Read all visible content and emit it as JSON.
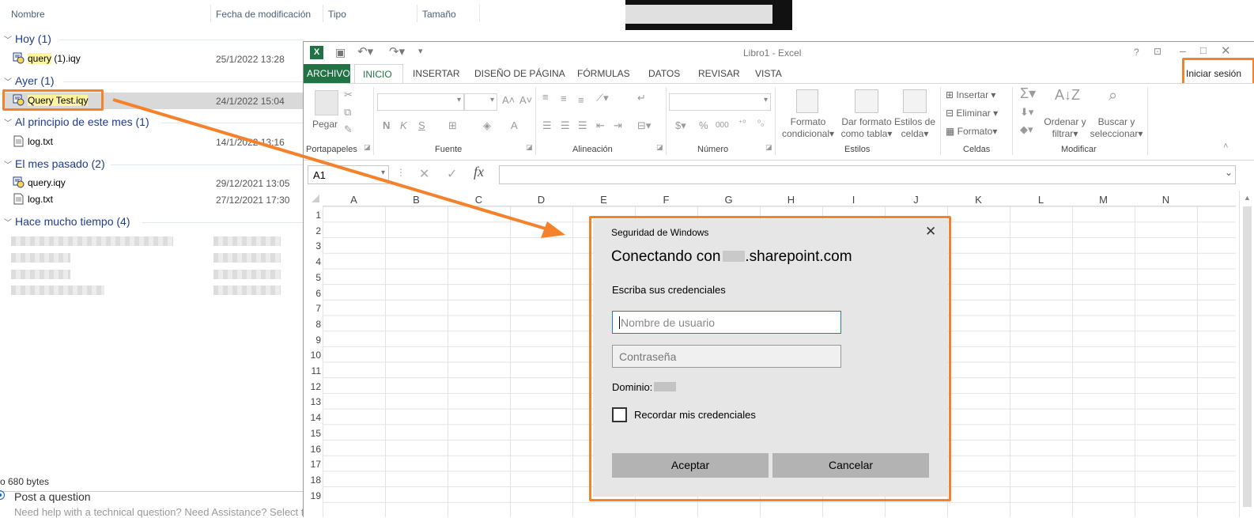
{
  "explorer": {
    "columns": [
      "Nombre",
      "Fecha de modificación",
      "Tipo",
      "Tamaño"
    ],
    "groups": [
      {
        "label": "Hoy (1)",
        "files": [
          {
            "name": "query (1).iqy",
            "hl": "query",
            "rest": " (1).iqy",
            "date": "25/1/2022 13:28"
          }
        ]
      },
      {
        "label": "Ayer (1)",
        "files": [
          {
            "name": "Query Test.iqy",
            "date": "24/1/2022 15:04"
          }
        ]
      },
      {
        "label": "Al principio de este mes (1)",
        "files": [
          {
            "name": "log.txt",
            "date": "14/1/2022 13:16"
          }
        ]
      },
      {
        "label": "El mes pasado (2)",
        "files": [
          {
            "name": "query.iqy",
            "date": "29/12/2021 13:05"
          },
          {
            "name": "log.txt",
            "date": "27/12/2021 17:30"
          }
        ]
      },
      {
        "label": "Hace mucho tiempo (4)",
        "files": []
      }
    ],
    "status": "o 680 bytes",
    "post_question": "Post a question",
    "post_help": "Need help with a technical question? Need Assistance? Select th"
  },
  "excel": {
    "title": "Libro1 - Excel",
    "signin": "Iniciar sesión",
    "help": "?",
    "tabs": [
      "ARCHIVO",
      "INICIO",
      "INSERTAR",
      "DISEÑO DE PÁGINA",
      "FÓRMULAS",
      "DATOS",
      "REVISAR",
      "VISTA"
    ],
    "ribbon": {
      "pegar": "Pegar",
      "portapapeles": "Portapapeles",
      "fuente": "Fuente",
      "alineacion": "Alineación",
      "numero": "Número",
      "estilos": "Estilos",
      "celdas": "Celdas",
      "modificar": "Modificar",
      "formato_condicional_1": "Formato",
      "formato_condicional_2": "condicional",
      "dar_formato_1": "Dar formato",
      "dar_formato_2": "como tabla",
      "estilos_celda_1": "Estilos de",
      "estilos_celda_2": "celda",
      "insertar": "Insertar",
      "eliminar": "Eliminar",
      "formato": "Formato",
      "ordenar_1": "Ordenar y",
      "ordenar_2": "filtrar",
      "buscar_1": "Buscar y",
      "buscar_2": "seleccionar",
      "bold": "N",
      "italic": "K",
      "underline": "S",
      "percent": "%",
      "thousands": "000"
    },
    "name_box": "A1",
    "fx": "fx",
    "columns": [
      "A",
      "B",
      "C",
      "D",
      "E",
      "F",
      "G",
      "H",
      "I",
      "J",
      "K",
      "L",
      "M",
      "N"
    ],
    "rows": [
      "1",
      "2",
      "3",
      "4",
      "5",
      "6",
      "7",
      "8",
      "9",
      "10",
      "11",
      "12",
      "13",
      "14",
      "15",
      "16",
      "17",
      "18",
      "19"
    ]
  },
  "dialog": {
    "title": "Seguridad de Windows",
    "heading_prefix": "Conectando con",
    "heading_suffix": ".sharepoint.com",
    "prompt": "Escriba sus credenciales",
    "username_placeholder": "Nombre de usuario",
    "password_placeholder": "Contraseña",
    "domain_label": "Dominio:",
    "remember": "Recordar mis credenciales",
    "accept": "Aceptar",
    "cancel": "Cancelar"
  },
  "colors": {
    "accent_orange": "#f5822a",
    "excel_green": "#217346",
    "group_blue": "#1e3c8c"
  }
}
